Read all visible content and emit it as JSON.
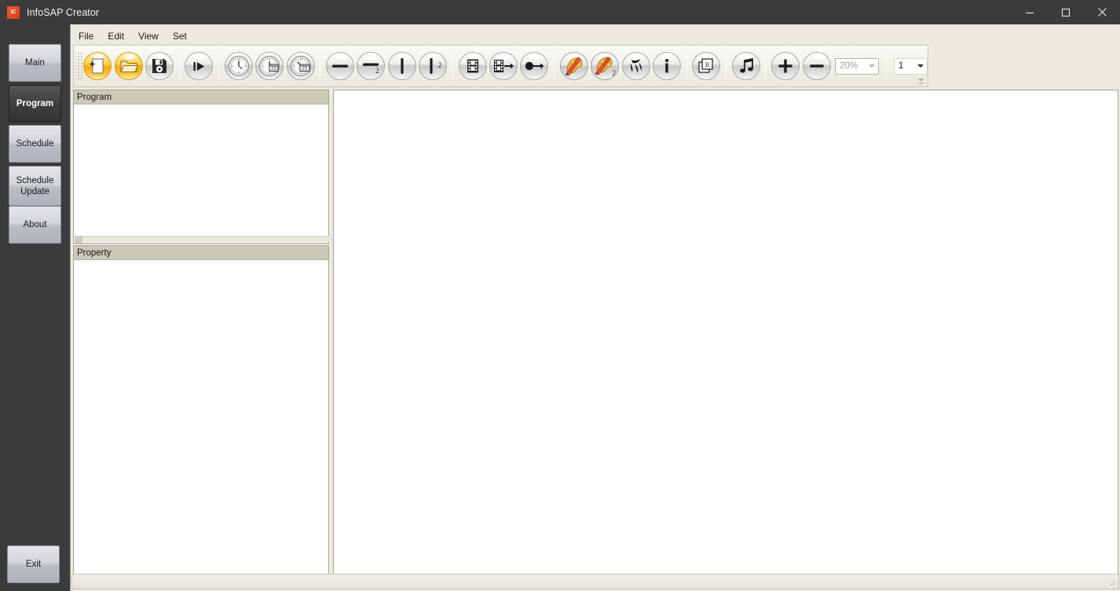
{
  "window": {
    "title": "InfoSAP Creator",
    "app_icon": "IC",
    "controls": {
      "minimize": "minimize-icon",
      "maximize": "maximize-icon",
      "close": "close-icon"
    },
    "titlebar_color": "#3b3b3b",
    "accent_color": "#f0582a"
  },
  "sidebar": {
    "background": "#3b3b3b",
    "items": [
      {
        "label": "Main",
        "active": false
      },
      {
        "label": "Program",
        "active": true
      },
      {
        "label": "Schedule",
        "active": false
      },
      {
        "label": "Schedule\nUpdate",
        "active": false
      },
      {
        "label": "About",
        "active": false
      }
    ],
    "exit_label": "Exit"
  },
  "menubar": {
    "items": [
      {
        "label": "File"
      },
      {
        "label": "Edit"
      },
      {
        "label": "View"
      },
      {
        "label": "Set"
      }
    ]
  },
  "toolbar": {
    "groups": [
      {
        "buttons": [
          {
            "icon": "new-document-icon",
            "label": "New",
            "style": "gold"
          },
          {
            "icon": "open-folder-icon",
            "label": "Open",
            "style": "gold"
          },
          {
            "icon": "save-floppy-icon",
            "label": "Save",
            "style": "gray"
          }
        ]
      },
      {
        "buttons": [
          {
            "icon": "play-icon",
            "label": "Play",
            "style": "gray"
          }
        ]
      },
      {
        "buttons": [
          {
            "icon": "clock-icon",
            "label": "Time",
            "style": "gray"
          },
          {
            "icon": "clock-calendar-icon",
            "label": "Date Time",
            "style": "gray",
            "badge": "23"
          },
          {
            "icon": "clock-calendar-alt-icon",
            "label": "Date Time 2",
            "style": "gray",
            "badge": "23"
          }
        ]
      },
      {
        "buttons": [
          {
            "icon": "horizontal-line-icon",
            "label": "Horizontal Line",
            "style": "gray"
          },
          {
            "icon": "horizontal-line-2-icon",
            "label": "Horizontal Line 2",
            "style": "gray",
            "sub": "2"
          },
          {
            "icon": "vertical-line-icon",
            "label": "Vertical Line",
            "style": "gray"
          },
          {
            "icon": "vertical-line-2-icon",
            "label": "Vertical Line 2",
            "style": "gray",
            "sub": "2"
          }
        ]
      },
      {
        "buttons": [
          {
            "icon": "film-strip-icon",
            "label": "Movie",
            "style": "gray"
          },
          {
            "icon": "film-strip-arrow-icon",
            "label": "Movie Scroll",
            "style": "gray"
          },
          {
            "icon": "dot-arrow-icon",
            "label": "Marquee",
            "style": "gray"
          }
        ]
      },
      {
        "buttons": [
          {
            "icon": "paint-palette-icon",
            "label": "Effect",
            "style": "color"
          },
          {
            "icon": "paint-palette-2-icon",
            "label": "Effect 2",
            "style": "color",
            "sub": "2"
          },
          {
            "icon": "note-flag-icon",
            "label": "Note",
            "style": "gray"
          },
          {
            "icon": "info-icon",
            "label": "Info",
            "style": "gray"
          }
        ]
      },
      {
        "buttons": [
          {
            "icon": "page-b-icon",
            "label": "Page B",
            "style": "gray",
            "letter": "B"
          }
        ]
      },
      {
        "buttons": [
          {
            "icon": "music-note-icon",
            "label": "Sound",
            "style": "gray"
          }
        ]
      },
      {
        "buttons": [
          {
            "icon": "plus-icon",
            "label": "Zoom In",
            "style": "gray"
          },
          {
            "icon": "minus-icon",
            "label": "Zoom Out",
            "style": "gray"
          }
        ]
      }
    ],
    "zoom_combo": {
      "value": "20%",
      "disabled": true
    },
    "page_combo": {
      "value": "1",
      "disabled": false
    },
    "overflow_icon": "toolbar-overflow-icon"
  },
  "panels": {
    "program": {
      "title": "Program",
      "content": ""
    },
    "property": {
      "title": "Property",
      "content": ""
    }
  },
  "canvas": {
    "content": ""
  },
  "statusbar": {
    "text": ""
  }
}
